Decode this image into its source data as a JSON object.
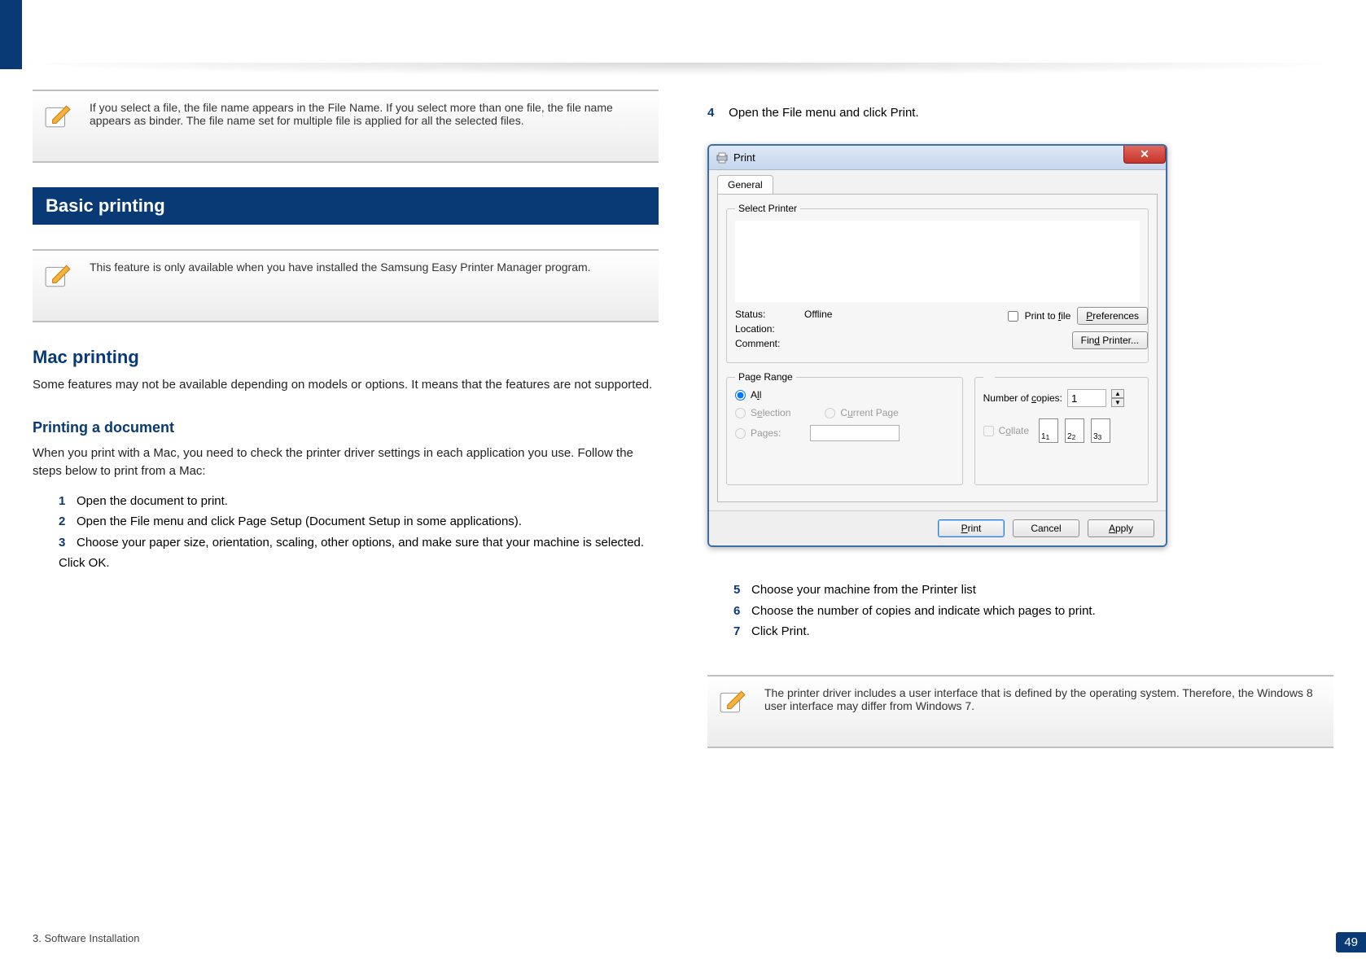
{
  "header": {
    "navy_accent": true
  },
  "left": {
    "note1": "If you select a file, the file name appears in the File Name. If you select more than one file, the file name appears as binder. The file name set for multiple file is applied for all the selected files.",
    "note2": "This feature is only available when you have installed the Samsung Easy Printer Manager program.",
    "section_title": "Basic printing",
    "mac_heading": "Mac printing",
    "mac_body": "Some features may not be available depending on models or options. It means that the features are not supported.",
    "mac_sub_heading": "Printing a document",
    "mac_sub_body": "When you print with a Mac, you need to check the printer driver settings in each application you use. Follow the steps below to print from a Mac:",
    "mac_steps": [
      "Open the document to print.",
      "Open the File menu and click Page Setup (Document Setup in some applications).",
      "Choose your paper size, orientation, scaling, other options, and make sure that your machine is selected. Click OK."
    ]
  },
  "right": {
    "lead": "Open the File menu and click Print.",
    "dialog": {
      "title": "Print",
      "tab": "General",
      "select_printer": "Select Printer",
      "status_label": "Status:",
      "status_value": "Offline",
      "location_label": "Location:",
      "comment_label": "Comment:",
      "print_to_file": "Print to file",
      "preferences_btn": "Preferences",
      "find_printer_btn": "Find Printer...",
      "page_range_legend": "Page Range",
      "radio_all": "All",
      "radio_selection": "Selection",
      "radio_current": "Current Page",
      "radio_pages": "Pages:",
      "copies_label": "Number of copies:",
      "copies_value": "1",
      "collate": "Collate",
      "collate_1": "1",
      "collate_2": "2",
      "collate_3": "3",
      "footer_print": "Print",
      "footer_cancel": "Cancel",
      "footer_apply": "Apply"
    },
    "after_steps": [
      "Choose your machine from the Printer list",
      "Choose the number of copies and indicate which pages to print.",
      "Click Print."
    ],
    "note3": "The printer driver includes a user interface that is defined by the operating system. Therefore, the Windows 8 user interface may differ from Windows 7."
  },
  "footer": {
    "doc_title": "3. Software Installation",
    "page_number": "49"
  }
}
